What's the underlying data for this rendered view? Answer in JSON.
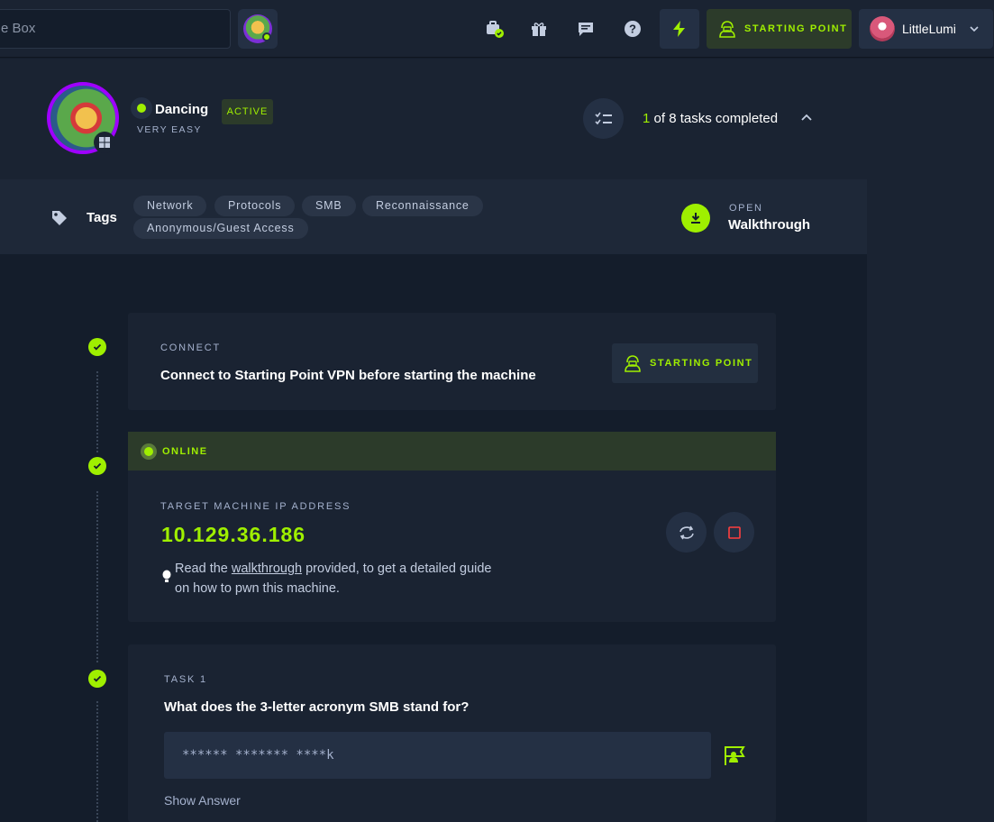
{
  "topbar": {
    "search_placeholder": "e Box",
    "starting_point_label": "STARTING POINT",
    "username": "LittleLumi",
    "icons": [
      "vpn-check-icon",
      "gift-icon",
      "chat-icon",
      "help-icon",
      "bolt-icon",
      "hacker-icon",
      "chevron-down-icon"
    ]
  },
  "machine": {
    "name": "Dancing",
    "status_badge": "ACTIVE",
    "difficulty": "VERY EASY",
    "os": "windows",
    "tasks_completed": "1",
    "tasks_suffix": "of 8 tasks completed"
  },
  "tags": {
    "label": "Tags",
    "items": [
      "Network",
      "Protocols",
      "SMB",
      "Reconnaissance",
      "Anonymous/Guest Access"
    ]
  },
  "walkthrough": {
    "open_label": "OPEN",
    "label": "Walkthrough"
  },
  "connect_card": {
    "label": "CONNECT",
    "title": "Connect to Starting Point VPN before starting the machine",
    "button_label": "STARTING POINT"
  },
  "target_card": {
    "status": "ONLINE",
    "label": "TARGET MACHINE IP ADDRESS",
    "ip": "10.129.36.186",
    "hint_before": "Read the ",
    "hint_link": "walkthrough",
    "hint_after": " provided, to get a detailed guide on how to pwn this machine."
  },
  "task1": {
    "label": "TASK 1",
    "question": "What does the 3-letter acronym SMB stand for?",
    "answer_mask": "****** ******* ****k",
    "show_answer": "Show Answer"
  },
  "colors": {
    "accent": "#9fef00",
    "background": "#141d2b",
    "panel": "#1a2332",
    "danger": "#ff3e3e"
  }
}
